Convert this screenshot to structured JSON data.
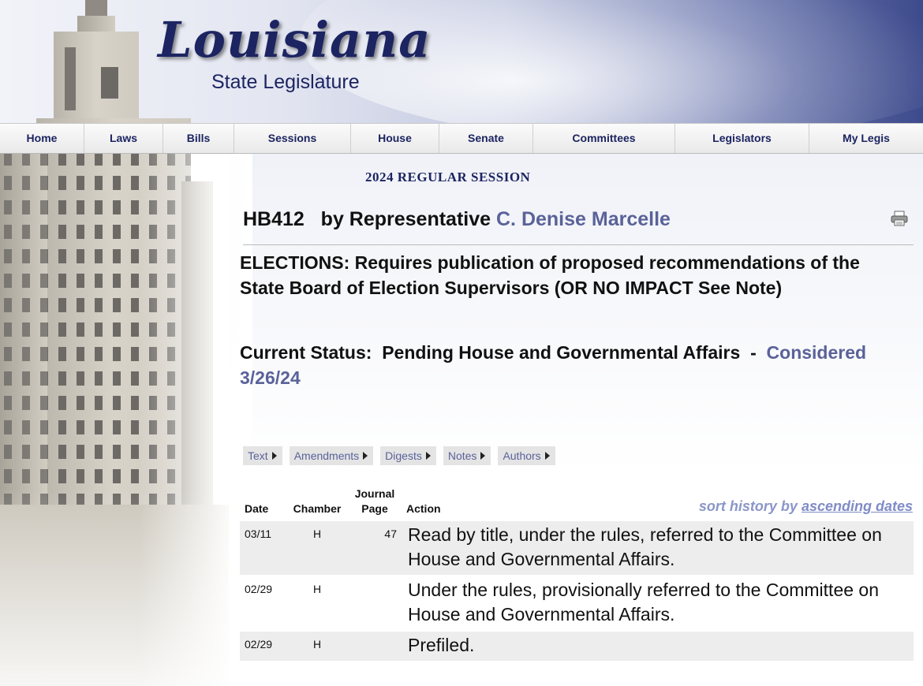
{
  "header": {
    "logo_main": "Louisiana",
    "logo_sub": "State Legislature"
  },
  "nav": {
    "items": [
      {
        "label": "Home"
      },
      {
        "label": "Laws"
      },
      {
        "label": "Bills"
      },
      {
        "label": "Sessions"
      },
      {
        "label": "House"
      },
      {
        "label": "Senate"
      },
      {
        "label": "Committees"
      },
      {
        "label": "Legislators"
      },
      {
        "label": "My Legis"
      }
    ]
  },
  "session": "2024 REGULAR SESSION",
  "bill": {
    "number": "HB412",
    "by_label": "by Representative",
    "author": "C. Denise Marcelle",
    "title": "ELECTIONS:  Requires publication of proposed recommendations of the State Board of Election Supervisors (OR NO IMPACT See Note)",
    "status_label": "Current Status:",
    "status_text": "Pending House and Governmental Affairs",
    "status_sep": "-",
    "status_link": "Considered 3/26/24"
  },
  "tabs": [
    {
      "label": "Text"
    },
    {
      "label": "Amendments"
    },
    {
      "label": "Digests"
    },
    {
      "label": "Notes"
    },
    {
      "label": "Authors"
    }
  ],
  "history": {
    "sort_prefix": "sort history by",
    "sort_link": "ascending dates",
    "columns": {
      "date": "Date",
      "chamber": "Chamber",
      "page_line1": "Journal",
      "page_line2": "Page",
      "action": "Action"
    },
    "rows": [
      {
        "date": "03/11",
        "chamber": "H",
        "page": "47",
        "action": "Read by title, under the rules, referred to the Committee on House and Governmental Affairs."
      },
      {
        "date": "02/29",
        "chamber": "H",
        "page": "",
        "action": "Under the rules, provisionally referred to the Committee on House and Governmental Affairs."
      },
      {
        "date": "02/29",
        "chamber": "H",
        "page": "",
        "action": "Prefiled."
      }
    ]
  },
  "icons": {
    "print": "printer-icon",
    "tab_arrow": "triangle-right-icon"
  },
  "colors": {
    "brand_navy": "#1c2461",
    "link_blue": "#5a6299",
    "sort_blue": "#7f8cc7"
  }
}
